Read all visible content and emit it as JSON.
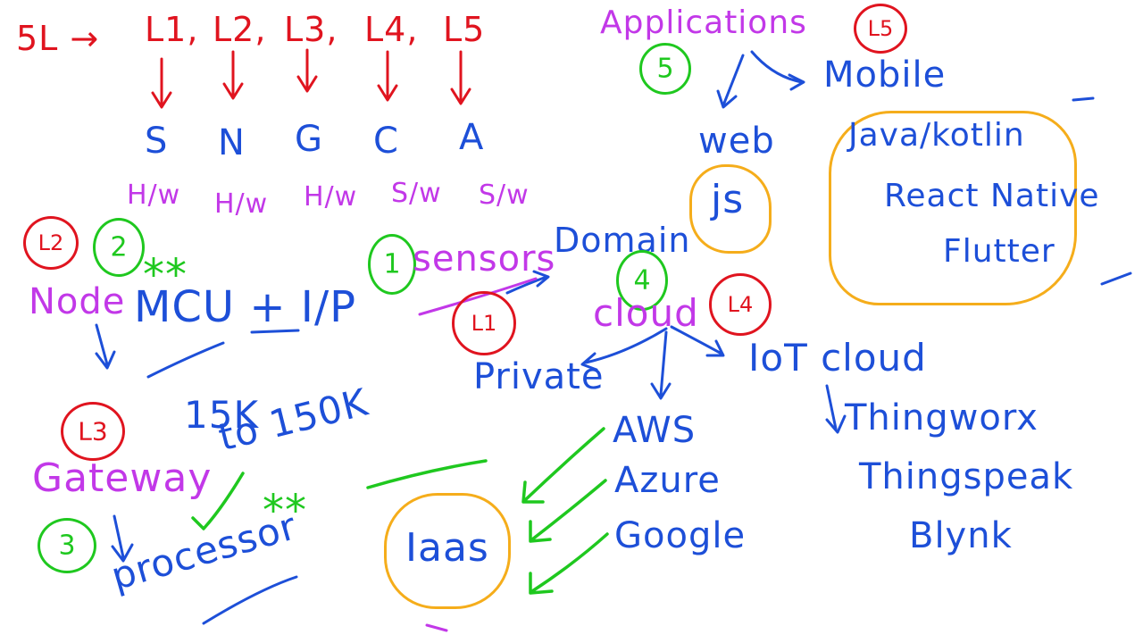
{
  "layers": {
    "label": "5L →",
    "names": [
      "L1,",
      "L2,",
      "L3,",
      "L4,",
      "L5"
    ],
    "letters": [
      "S",
      "N",
      "G",
      "C",
      "A"
    ],
    "kinds": [
      "H/w",
      "H/w",
      "H/w",
      "S/w",
      "S/w"
    ]
  },
  "application": {
    "title": "Applications",
    "badge_num": "5",
    "badge_layer": "L5",
    "web": "web",
    "web_tech": "js",
    "mobile": "Mobile",
    "mobile_tech": [
      "Java/kotlin",
      "React Native",
      "Flutter"
    ]
  },
  "node": {
    "badge_layer": "L2",
    "badge_num": "2",
    "label": "Node",
    "stars": "**",
    "detail": "MCU + I/P"
  },
  "sensors": {
    "badge_num": "1",
    "label": "sensors",
    "badge_layer": "L1",
    "domain": "Domain"
  },
  "cloud": {
    "badge_num": "4",
    "label": "cloud",
    "badge_layer": "L4",
    "private": "Private",
    "providers": [
      "AWS",
      "Azure",
      "Google"
    ],
    "iaas": "Iaas",
    "iot_cloud": "IoT cloud",
    "iot_platforms": [
      "Thingworx",
      "Thingspeak",
      "Blynk"
    ]
  },
  "gateway": {
    "badge_layer": "L3",
    "label": "Gateway",
    "badge_num": "3",
    "price": [
      "15K",
      "to 150K"
    ],
    "processor": "processor",
    "stars": "**"
  },
  "colors": {
    "red": "#e0141f",
    "blue": "#1d4fd8",
    "magenta": "#c238e8",
    "green": "#1fc81f",
    "orange": "#f5ad1b"
  }
}
